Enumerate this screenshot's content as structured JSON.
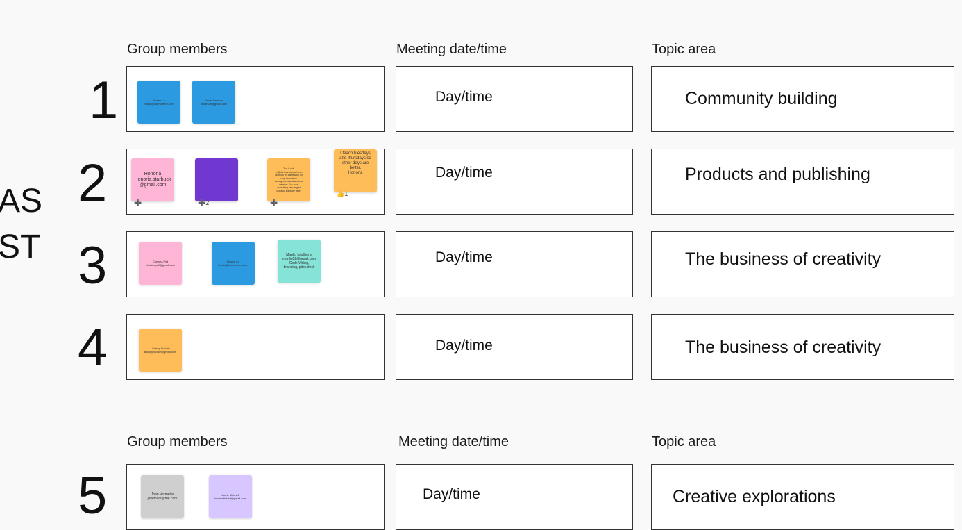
{
  "side_text": {
    "line1": "AS",
    "line2": "ST"
  },
  "section1": {
    "headers": {
      "members": "Group members",
      "meeting": "Meeting date/time",
      "topic": "Topic area"
    },
    "rows": [
      {
        "number": "1",
        "meeting": "Day/time",
        "topic": "Community building",
        "stickies": [
          {
            "text": "Bowen Lo\nbowlo@coursehero.com",
            "color": "#2b9ae0"
          },
          {
            "text": "Oscar Dawson\noscarson@gmail.com",
            "color": "#2b9ae0"
          }
        ]
      },
      {
        "number": "2",
        "meeting": "Day/time",
        "topic": "Products and publishing",
        "stickies": [
          {
            "text": "Honoria\nHonoria.starbuck\n@gmail.com",
            "color": "#ffb5d6",
            "reaction": "➕"
          },
          {
            "text": "",
            "color": "#7037d1",
            "reaction": "➕2"
          },
          {
            "text": "Zoe Cobb\nzc@dortmund.gmail.com\nWorking on framework for\ncorp innovation\nmanagement and wireless\ncreation. For cola,\nconsulting new angler\nbut also software later.",
            "color": "#ffbd59",
            "reaction": "➕"
          },
          {
            "text": "I teach tuesdays\nand thursdays so\nother days are\nbetter.\nHonoria",
            "color": "#ffbd59",
            "reaction": "👍1"
          }
        ]
      },
      {
        "number": "3",
        "meeting": "Day/time",
        "topic": "The business of creativity",
        "stickies": [
          {
            "text": "Chelsea Pell\nchelseapell@gmail.com",
            "color": "#ffb5d6"
          },
          {
            "text": "Bowen Lo\nbowlo@coursehero.com",
            "color": "#2b9ae0"
          },
          {
            "text": "Manlio IoloBerna\nmanlio52@gmail.com\nCode Vibing,\nbranding, pitch deck",
            "color": "#86e3d8"
          }
        ]
      },
      {
        "number": "4",
        "meeting": "Day/time",
        "topic": "The business of creativity",
        "stickies": [
          {
            "text": "Lindsey Nodale\nlindseynodale@gmail.com",
            "color": "#ffbd59"
          }
        ]
      }
    ]
  },
  "section2": {
    "headers": {
      "members": "Group members",
      "meeting": "Meeting date/time",
      "topic": "Topic area"
    },
    "rows": [
      {
        "number": "5",
        "meeting": "Day/time",
        "topic": "Creative explorations",
        "stickies": [
          {
            "text": "Joan Vermette\njayeffvee@me.com",
            "color": "#cfcfcf"
          },
          {
            "text": "Lorrie Mitchell\nlorrie.mitchell@gmail.com",
            "color": "#d7c6ff"
          }
        ]
      }
    ]
  }
}
